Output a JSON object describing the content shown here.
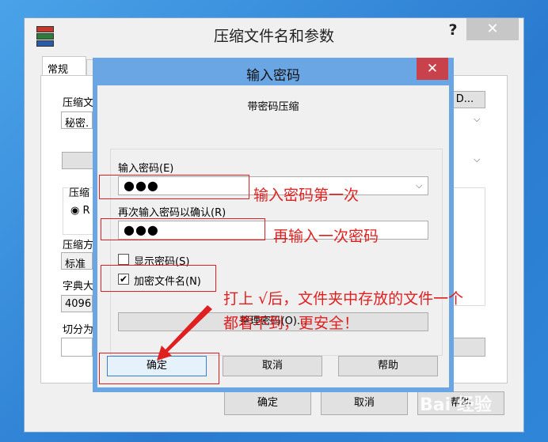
{
  "outer": {
    "title": "压缩文件名和参数",
    "help": "?",
    "close": "✕",
    "tab_general": "常规",
    "archive_name_label": "压缩文",
    "archive_name_value": "秘密.",
    "browse_label": "D...",
    "format_label": "压缩",
    "format_radio_label": "R",
    "method_label": "压缩方",
    "method_value": "标准",
    "dict_label": "字典大",
    "dict_value": "4096",
    "split_label": "切分为",
    "ok": "确定",
    "cancel": "取消",
    "help_button": "帮助"
  },
  "dialog": {
    "title": "输入密码",
    "close": "✕",
    "subtitle": "带密码压缩",
    "pw_label": "输入密码(E)",
    "pw_value": "●●●",
    "confirm_label": "再次输入密码以确认(R)",
    "confirm_value": "●●●",
    "show_pw_label": "显示密码(S)",
    "encrypt_names_label": "加密文件名(N)",
    "encrypt_names_check": "✔",
    "manage_label": "整理密码(O)...",
    "ok": "确定",
    "cancel": "取消",
    "help": "帮助"
  },
  "annotations": {
    "first": "输入密码第一次",
    "second": "再输入一次密码",
    "tip_line1": "打上 √后，文件夹中存放的文件一个",
    "tip_line2": "都看不到，更安全！",
    "accent": "#e02020"
  },
  "watermark": "Bai 经验"
}
